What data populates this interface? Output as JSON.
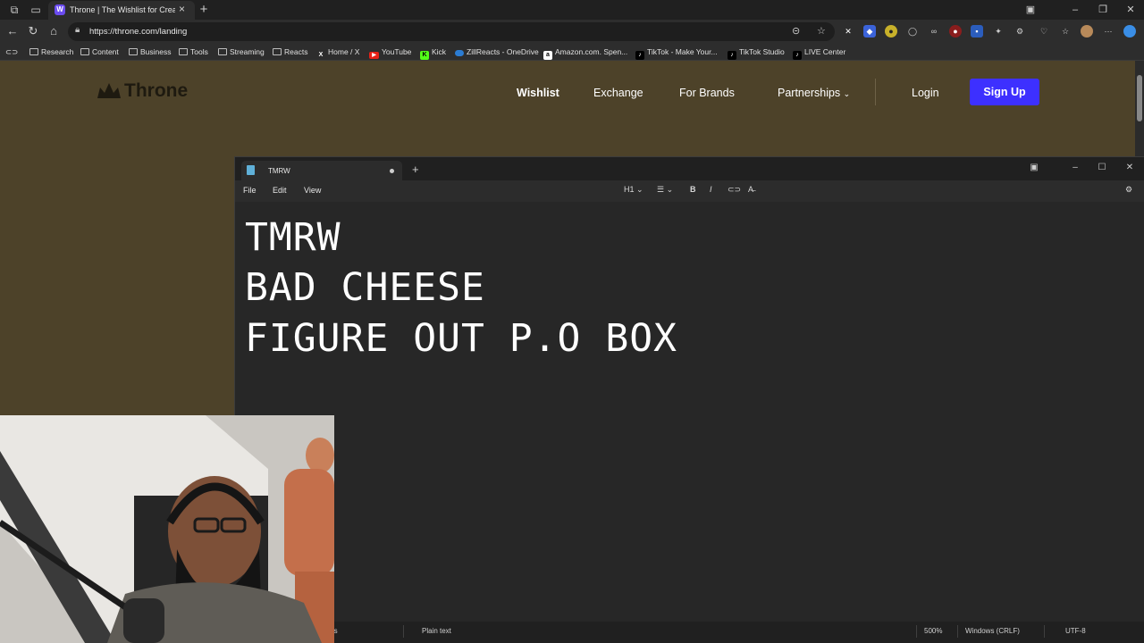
{
  "browser": {
    "tab_title": "Throne | The Wishlist for Creators",
    "tab_favicon": "W",
    "url": "https://throne.com/landing",
    "bookmarks": [
      {
        "label": "Research",
        "icon": "folder-icon"
      },
      {
        "label": "Content",
        "icon": "folder-icon"
      },
      {
        "label": "Business",
        "icon": "folder-icon"
      },
      {
        "label": "Tools",
        "icon": "folder-icon"
      },
      {
        "label": "Streaming",
        "icon": "folder-icon"
      },
      {
        "label": "Reacts",
        "icon": "folder-icon"
      },
      {
        "label": "Home / X",
        "icon": "x-logo-icon"
      },
      {
        "label": "YouTube",
        "icon": "youtube-icon"
      },
      {
        "label": "Kick",
        "icon": "kick-icon"
      },
      {
        "label": "ZillReacts - OneDrive",
        "icon": "onedrive-icon"
      },
      {
        "label": "Amazon.com. Spen...",
        "icon": "amazon-icon"
      },
      {
        "label": "TikTok - Make Your...",
        "icon": "tiktok-icon"
      },
      {
        "label": "TikTok Studio",
        "icon": "tiktok-icon"
      },
      {
        "label": "LIVE Center",
        "icon": "tiktok-icon"
      }
    ]
  },
  "site": {
    "logo_text": "Throne",
    "nav": {
      "wishlist": "Wishlist",
      "exchange": "Exchange",
      "for_brands": "For Brands",
      "partnerships": "Partnerships",
      "login": "Login",
      "signup": "Sign Up"
    },
    "colors": {
      "background": "#4d4229",
      "signup": "#3d30ff"
    }
  },
  "notepad": {
    "tab_title": "TMRW",
    "menu": {
      "file": "File",
      "edit": "Edit",
      "view": "View"
    },
    "toolbar": {
      "heading": "H1"
    },
    "lines": [
      "TMRW",
      "BAD CHEESE",
      "FIGURE OUT P.O BOX"
    ],
    "status": {
      "partial": "rs",
      "mode": "Plain text",
      "zoom": "500%",
      "line_ending": "Windows (CRLF)",
      "encoding": "UTF-8"
    }
  }
}
